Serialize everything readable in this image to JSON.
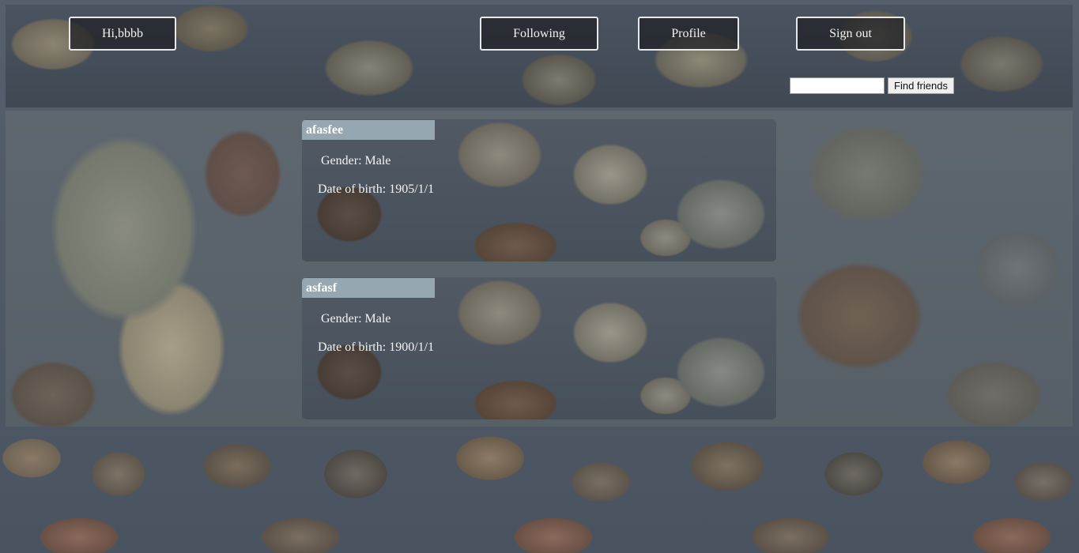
{
  "header": {
    "greeting": "Hi,bbbb",
    "nav": {
      "following": "Following",
      "profile": "Profile",
      "sign_out": "Sign out"
    },
    "search": {
      "value": "",
      "placeholder": "",
      "button_label": "Find friends"
    }
  },
  "following": [
    {
      "username": "afasfee",
      "gender": "Gender: Male",
      "date_of_birth": "Date of birth: 1905/1/1"
    },
    {
      "username": "asfasf",
      "gender": "Gender: Male",
      "date_of_birth": "Date of birth: 1900/1/1"
    }
  ]
}
